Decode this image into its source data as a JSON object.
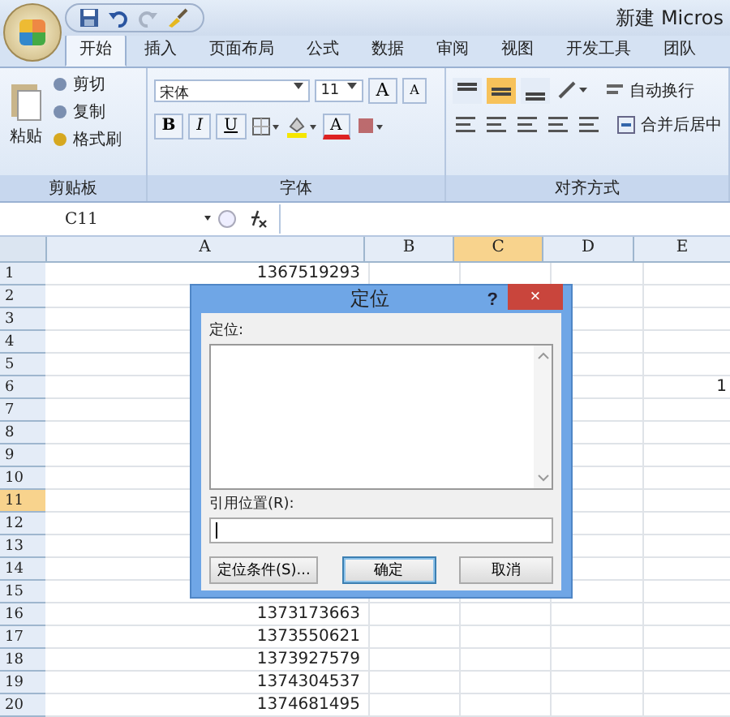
{
  "window": {
    "title": "新建 Micros"
  },
  "tabs": [
    {
      "label": "开始",
      "selected": true
    },
    {
      "label": "插入",
      "selected": false
    },
    {
      "label": "页面布局",
      "selected": false
    },
    {
      "label": "公式",
      "selected": false
    },
    {
      "label": "数据",
      "selected": false
    },
    {
      "label": "审阅",
      "selected": false
    },
    {
      "label": "视图",
      "selected": false
    },
    {
      "label": "开发工具",
      "selected": false
    },
    {
      "label": "团队",
      "selected": false
    }
  ],
  "clipboard": {
    "label": "剪贴板",
    "paste": "粘贴",
    "items": [
      "剪切",
      "复制",
      "格式刷"
    ]
  },
  "font_group": {
    "label": "字体",
    "font_name": "宋体",
    "font_size": "11",
    "grow": "A",
    "shrink": "A",
    "bold": "B",
    "italic": "I",
    "underline": "U",
    "font_color": "A"
  },
  "alignment": {
    "label": "对齐方式",
    "vertical": [
      {
        "selected": false
      },
      {
        "selected": true
      },
      {
        "selected": false
      }
    ],
    "wrap": "自动换行",
    "merge": "合并后居中"
  },
  "formula_bar": {
    "name_box": "C11"
  },
  "columns": [
    {
      "label": "A",
      "selected": false
    },
    {
      "label": "B",
      "selected": false
    },
    {
      "label": "C",
      "selected": true
    },
    {
      "label": "D",
      "selected": false
    },
    {
      "label": "E",
      "selected": false
    }
  ],
  "rows": [
    {
      "number": "1",
      "selected": false,
      "a": "1367519293"
    },
    {
      "number": "2",
      "selected": false
    },
    {
      "number": "3",
      "selected": false
    },
    {
      "number": "4",
      "selected": false
    },
    {
      "number": "5",
      "selected": false
    },
    {
      "number": "6",
      "selected": false,
      "e": "1"
    },
    {
      "number": "7",
      "selected": false
    },
    {
      "number": "8",
      "selected": false
    },
    {
      "number": "9",
      "selected": false
    },
    {
      "number": "10",
      "selected": false
    },
    {
      "number": "11",
      "selected": true
    },
    {
      "number": "12",
      "selected": false
    },
    {
      "number": "13",
      "selected": false
    },
    {
      "number": "14",
      "selected": false
    },
    {
      "number": "15",
      "selected": false
    },
    {
      "number": "16",
      "selected": false,
      "a": "1373173663"
    },
    {
      "number": "17",
      "selected": false,
      "a": "1373550621"
    },
    {
      "number": "18",
      "selected": false,
      "a": "1373927579"
    },
    {
      "number": "19",
      "selected": false,
      "a": "1374304537"
    },
    {
      "number": "20",
      "selected": false,
      "a": "1374681495"
    }
  ],
  "dialog": {
    "title": "定位",
    "help": "?",
    "close": "×",
    "list_label": "定位:",
    "reference_label": "引用位置(R):",
    "buttons": [
      {
        "label": "定位条件(S)...",
        "default": false
      },
      {
        "label": "确定",
        "default": true
      },
      {
        "label": "取消",
        "default": false
      }
    ]
  }
}
